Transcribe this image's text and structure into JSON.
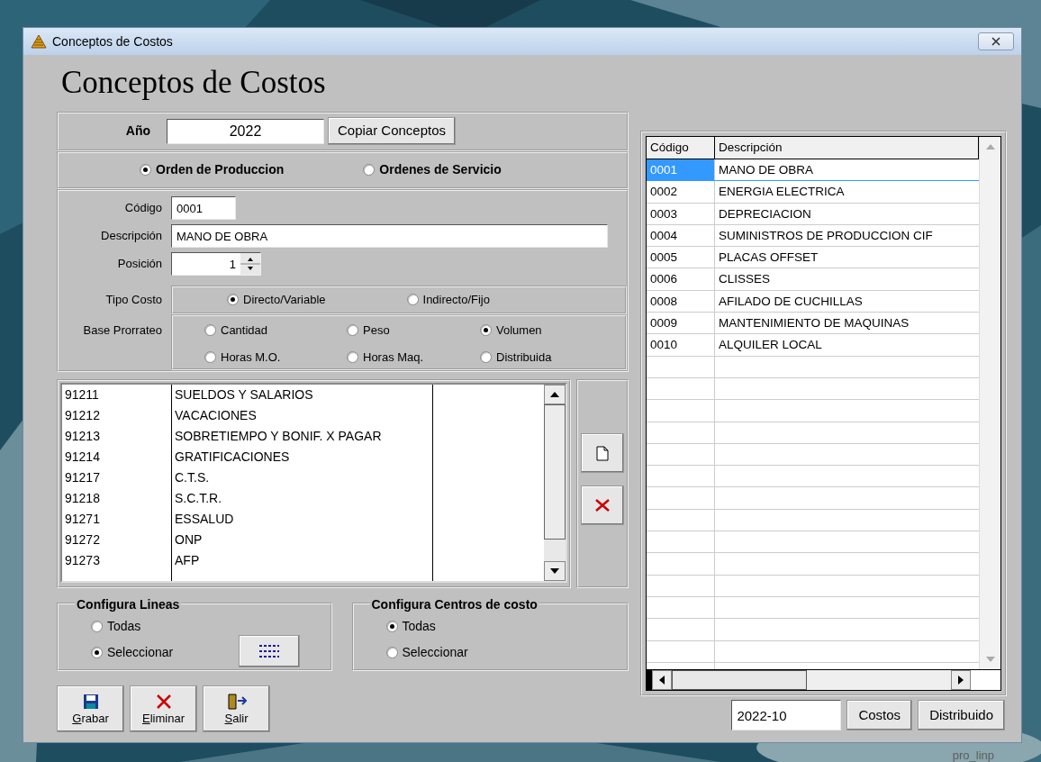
{
  "window": {
    "title": "Conceptos de Costos"
  },
  "heading": "Conceptos de Costos",
  "year": {
    "label": "Año",
    "value": "2022"
  },
  "copy_button": "Copiar Conceptos",
  "order_types": [
    {
      "label": "Orden de Produccion",
      "selected": true
    },
    {
      "label": "Ordenes de Servicio",
      "selected": false
    }
  ],
  "fields": [
    {
      "label": "Código",
      "value": "0001",
      "kind": "short"
    },
    {
      "label": "Descripción",
      "value": "MANO DE OBRA",
      "kind": "long"
    },
    {
      "label": "Posición",
      "value": "1",
      "kind": "spinner"
    }
  ],
  "tipo_costo": {
    "label": "Tipo Costo",
    "options": [
      {
        "label": "Directo/Variable",
        "selected": true
      },
      {
        "label": "Indirecto/Fijo",
        "selected": false
      }
    ]
  },
  "base_prorrateo": {
    "label": "Base Prorrateo",
    "options": [
      {
        "label": "Cantidad",
        "selected": false
      },
      {
        "label": "Peso",
        "selected": false
      },
      {
        "label": "Volumen",
        "selected": true
      },
      {
        "label": "Horas M.O.",
        "selected": false
      },
      {
        "label": "Horas Maq.",
        "selected": false
      },
      {
        "label": "Distribuida",
        "selected": false
      }
    ]
  },
  "accounts": [
    {
      "code": "91211",
      "name": "SUELDOS Y SALARIOS"
    },
    {
      "code": "91212",
      "name": "VACACIONES"
    },
    {
      "code": "91213",
      "name": "SOBRETIEMPO Y BONIF. X PAGAR"
    },
    {
      "code": "91214",
      "name": "GRATIFICACIONES"
    },
    {
      "code": "91217",
      "name": "C.T.S."
    },
    {
      "code": "91218",
      "name": "S.C.T.R."
    },
    {
      "code": "91271",
      "name": "ESSALUD"
    },
    {
      "code": "91272",
      "name": "ONP"
    },
    {
      "code": "91273",
      "name": "AFP"
    }
  ],
  "config_lineas": {
    "title": "Configura Lineas",
    "options": [
      {
        "label": "Todas",
        "selected": false
      },
      {
        "label": "Seleccionar",
        "selected": true
      }
    ]
  },
  "config_centros": {
    "title": "Configura Centros de costo",
    "options": [
      {
        "label": "Todas",
        "selected": true
      },
      {
        "label": "Seleccionar",
        "selected": false
      }
    ]
  },
  "action_buttons": [
    {
      "label": "Grabar",
      "kind": "save"
    },
    {
      "label": "Eliminar",
      "kind": "delete"
    },
    {
      "label": "Salir",
      "kind": "exit"
    }
  ],
  "table": {
    "columns": [
      "Código",
      "Descripción"
    ],
    "rows": [
      {
        "code": "0001",
        "description": "MANO DE OBRA",
        "selected": true
      },
      {
        "code": "0002",
        "description": "ENERGIA ELECTRICA",
        "selected": false
      },
      {
        "code": "0003",
        "description": "DEPRECIACION",
        "selected": false
      },
      {
        "code": "0004",
        "description": "SUMINISTROS DE PRODUCCION CIF",
        "selected": false
      },
      {
        "code": "0005",
        "description": "PLACAS OFFSET",
        "selected": false
      },
      {
        "code": "0006",
        "description": "CLISSES",
        "selected": false
      },
      {
        "code": "0008",
        "description": "AFILADO DE CUCHILLAS",
        "selected": false
      },
      {
        "code": "0009",
        "description": "MANTENIMIENTO DE MAQUINAS",
        "selected": false
      },
      {
        "code": "0010",
        "description": "ALQUILER LOCAL",
        "selected": false
      }
    ]
  },
  "period": {
    "value": "2022-10"
  },
  "bottom_buttons": [
    "Costos",
    "Distribuido"
  ],
  "footer": "pro_linp"
}
